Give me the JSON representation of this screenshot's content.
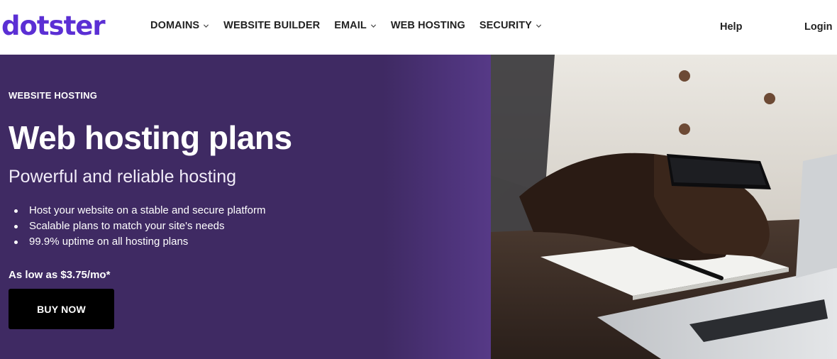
{
  "header": {
    "logo_text": "dotster",
    "nav": [
      {
        "label": "DOMAINS",
        "has_dropdown": true
      },
      {
        "label": "WEBSITE BUILDER",
        "has_dropdown": false
      },
      {
        "label": "EMAIL",
        "has_dropdown": true
      },
      {
        "label": "WEB HOSTING",
        "has_dropdown": false
      },
      {
        "label": "SECURITY",
        "has_dropdown": true
      }
    ],
    "help_label": "Help",
    "login_label": "Login"
  },
  "hero": {
    "eyebrow": "WEBSITE HOSTING",
    "title": "Web hosting plans",
    "subtitle": "Powerful and reliable hosting",
    "features": [
      "Host your website on a stable and secure platform",
      "Scalable plans to match your site's needs",
      "99.9% uptime on all hosting plans"
    ],
    "price": "As low as $3.75/mo*",
    "buy_label": "BUY NOW"
  },
  "colors": {
    "brand": "#5b2fd4",
    "hero_bg": "#3f2a63",
    "button_bg": "#000000"
  },
  "icons": [
    "chevron-down-icon"
  ]
}
